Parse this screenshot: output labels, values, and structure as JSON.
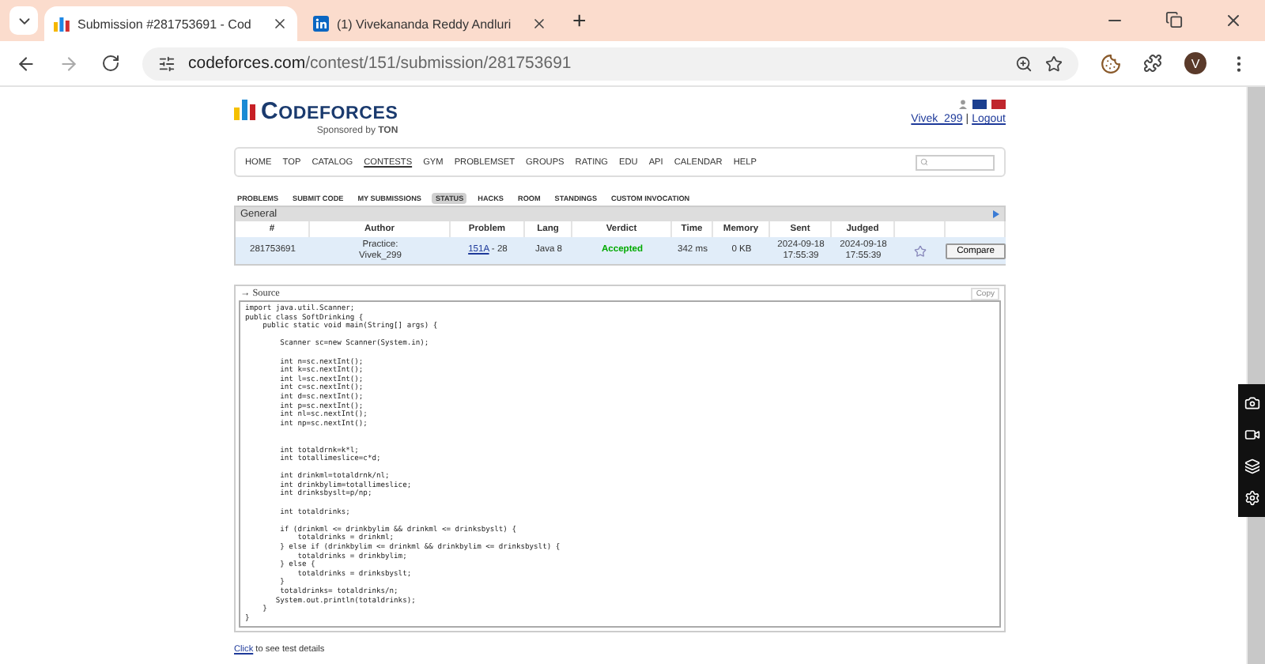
{
  "browser": {
    "tabs": [
      {
        "title": "Submission #281753691 - Cod",
        "selected": true,
        "kind": "bars"
      },
      {
        "title": "(1) Vivekananda Reddy Andluri",
        "selected": false,
        "kind": "in"
      }
    ],
    "new_tab": "+",
    "url_host": "codeforces.com",
    "url_path": "/contest/151/submission/281753691",
    "avatar": "V"
  },
  "header": {
    "logo_first": "C",
    "logo_rest": "ODEFORCES",
    "sponsor": "Sponsored by",
    "sponsor_brand": "TON",
    "user": "Vivek_299",
    "separator": "|",
    "logout": "Logout"
  },
  "nav": [
    {
      "label": "HOME",
      "selected": false
    },
    {
      "label": "TOP",
      "selected": false
    },
    {
      "label": "CATALOG",
      "selected": false
    },
    {
      "label": "CONTESTS",
      "selected": true
    },
    {
      "label": "GYM",
      "selected": false
    },
    {
      "label": "PROBLEMSET",
      "selected": false
    },
    {
      "label": "GROUPS",
      "selected": false
    },
    {
      "label": "RATING",
      "selected": false
    },
    {
      "label": "EDU",
      "selected": false
    },
    {
      "label": "API",
      "selected": false
    },
    {
      "label": "CALENDAR",
      "selected": false
    },
    {
      "label": "HELP",
      "selected": false
    }
  ],
  "subnav": [
    {
      "label": "PROBLEMS",
      "selected": false
    },
    {
      "label": "SUBMIT CODE",
      "selected": false
    },
    {
      "label": "MY SUBMISSIONS",
      "selected": false
    },
    {
      "label": "STATUS",
      "selected": true
    },
    {
      "label": "HACKS",
      "selected": false
    },
    {
      "label": "ROOM",
      "selected": false
    },
    {
      "label": "STANDINGS",
      "selected": false
    },
    {
      "label": "CUSTOM INVOCATION",
      "selected": false
    }
  ],
  "table": {
    "title": "General",
    "columns": [
      "#",
      "Author",
      "Problem",
      "Lang",
      "Verdict",
      "Time",
      "Memory",
      "Sent",
      "Judged"
    ],
    "row": {
      "id": "281753691",
      "author_prefix": "Practice:",
      "author": "Vivek_299",
      "problem_link": "151A",
      "problem_rest": " - 28",
      "lang": "Java 8",
      "verdict": "Accepted",
      "time": "342 ms",
      "memory": "0 KB",
      "sent": [
        "2024-09-18",
        "17:55:39"
      ],
      "judged": [
        "2024-09-18",
        "17:55:39"
      ],
      "compare": "Compare"
    }
  },
  "source": {
    "title": "→ Source",
    "copy": "Copy",
    "code": "import java.util.Scanner;\npublic class SoftDrinking {\n    public static void main(String[] args) {\n\n        Scanner sc=new Scanner(System.in);\n\n        int n=sc.nextInt();\n        int k=sc.nextInt();\n        int l=sc.nextInt();\n        int c=sc.nextInt();\n        int d=sc.nextInt();\n        int p=sc.nextInt();\n        int nl=sc.nextInt();\n        int np=sc.nextInt();\n\n\n        int totaldrnk=k*l;\n        int totallimeslice=c*d;\n\n        int drinkml=totaldrnk/nl;\n        int drinkbylim=totallimeslice;\n        int drinksbyslt=p/np;\n\n        int totaldrinks;\n\n        if (drinkml <= drinkbylim && drinkml <= drinksbyslt) {\n            totaldrinks = drinkml;\n        } else if (drinkbylim <= drinkml && drinkbylim <= drinksbyslt) {\n            totaldrinks = drinkbylim;\n        } else {\n            totaldrinks = drinksbyslt;\n        }\n        totaldrinks= totaldrinks/n;\n       System.out.println(totaldrinks);\n    }\n}"
  },
  "footer": {
    "link": "Click",
    "rest": " to see test details"
  }
}
